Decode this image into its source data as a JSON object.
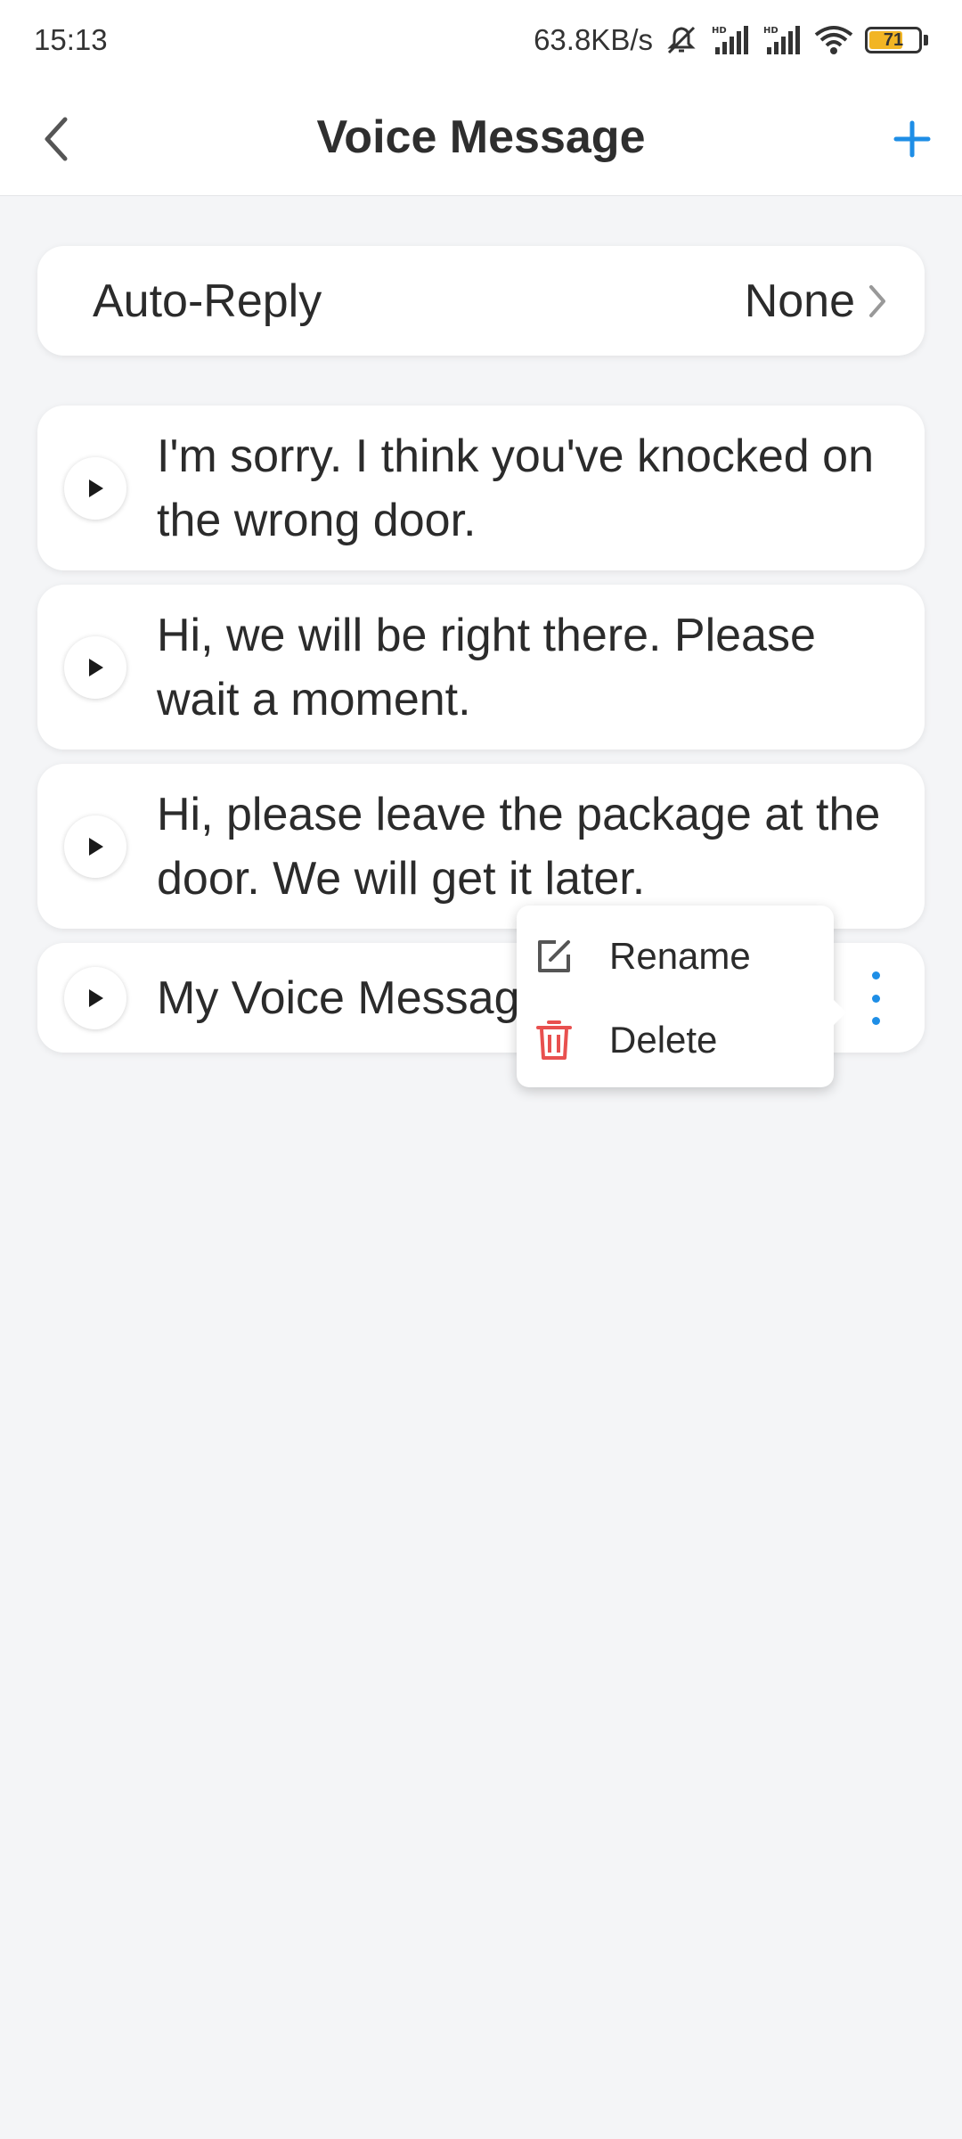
{
  "status_bar": {
    "time": "15:13",
    "network_speed": "63.8KB/s",
    "battery_level": "71"
  },
  "header": {
    "title": "Voice Message"
  },
  "auto_reply": {
    "label": "Auto-Reply",
    "value": "None"
  },
  "messages": [
    {
      "text": "I'm sorry. I think you've knocked on the wrong door."
    },
    {
      "text": "Hi, we will be right there. Please wait a moment."
    },
    {
      "text": "Hi, please leave the package at the door. We will get it later."
    },
    {
      "text": "My Voice Message"
    }
  ],
  "context_menu": {
    "rename_label": "Rename",
    "delete_label": "Delete"
  },
  "colors": {
    "accent": "#1e8ee6",
    "delete_red": "#e8504f",
    "battery": "#f2b524",
    "background": "#f4f5f7"
  }
}
